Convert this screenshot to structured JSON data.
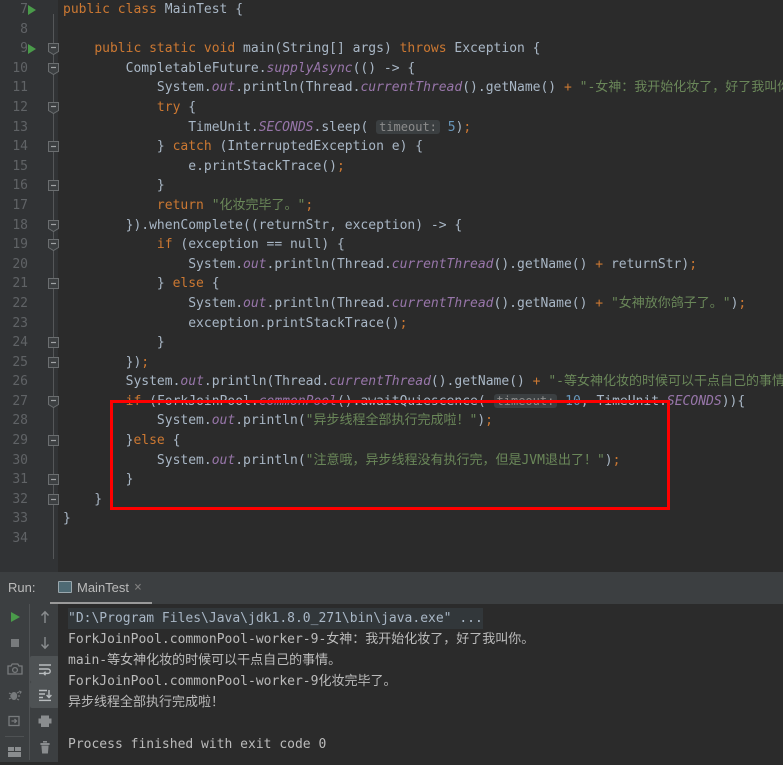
{
  "editor": {
    "first_line": 7,
    "lines": [
      {
        "n": 7,
        "run": true,
        "fold": "none"
      },
      {
        "n": 8,
        "run": false,
        "fold": "none"
      },
      {
        "n": 9,
        "run": true,
        "fold": "open-start"
      },
      {
        "n": 10,
        "run": false,
        "fold": "open-start"
      },
      {
        "n": 11,
        "run": false,
        "fold": "none"
      },
      {
        "n": 12,
        "run": false,
        "fold": "open-start"
      },
      {
        "n": 13,
        "run": false,
        "fold": "none"
      },
      {
        "n": 14,
        "run": false,
        "fold": "open-mid"
      },
      {
        "n": 15,
        "run": false,
        "fold": "none"
      },
      {
        "n": 16,
        "run": false,
        "fold": "open-mid"
      },
      {
        "n": 17,
        "run": false,
        "fold": "none"
      },
      {
        "n": 18,
        "run": false,
        "fold": "open-start"
      },
      {
        "n": 19,
        "run": false,
        "fold": "open-start"
      },
      {
        "n": 20,
        "run": false,
        "fold": "none"
      },
      {
        "n": 21,
        "run": false,
        "fold": "open-mid"
      },
      {
        "n": 22,
        "run": false,
        "fold": "none"
      },
      {
        "n": 23,
        "run": false,
        "fold": "none"
      },
      {
        "n": 24,
        "run": false,
        "fold": "open-mid"
      },
      {
        "n": 25,
        "run": false,
        "fold": "open-mid"
      },
      {
        "n": 26,
        "run": false,
        "fold": "none"
      },
      {
        "n": 27,
        "run": false,
        "fold": "open-start"
      },
      {
        "n": 28,
        "run": false,
        "fold": "none"
      },
      {
        "n": 29,
        "run": false,
        "fold": "open-mid"
      },
      {
        "n": 30,
        "run": false,
        "fold": "none"
      },
      {
        "n": 31,
        "run": false,
        "fold": "open-mid"
      },
      {
        "n": 32,
        "run": false,
        "fold": "open-mid"
      },
      {
        "n": 33,
        "run": false,
        "fold": "none"
      },
      {
        "n": 34,
        "run": false,
        "fold": "none"
      }
    ],
    "code_lines": [
      "public class MainTest {",
      "",
      "    public static void main(String[] args) throws Exception {",
      "        CompletableFuture.supplyAsync(() -> {",
      "            System.out.println(Thread.currentThread().getName() + \"-女神：我开始化妆了，好了我叫你。\");",
      "            try {",
      "                TimeUnit.SECONDS.sleep( timeout: 5);",
      "            } catch (InterruptedException e) {",
      "                e.printStackTrace();",
      "            }",
      "            return \"化妆完毕了。\";",
      "        }).whenComplete((returnStr, exception) -> {",
      "            if (exception == null) {",
      "                System.out.println(Thread.currentThread().getName() + returnStr);",
      "            } else {",
      "                System.out.println(Thread.currentThread().getName() + \"女神放你鸽子了。\");",
      "                exception.printStackTrace();",
      "            }",
      "        });",
      "        System.out.println(Thread.currentThread().getName() + \"-等女神化妆的时候可以干点自己的事情。\");",
      "        if (ForkJoinPool.commonPool().awaitQuiescence( timeout: 10, TimeUnit.SECONDS)){",
      "            System.out.println(\"异步线程全部执行完成啦！\");",
      "        }else {",
      "            System.out.println(\"注意哦，异步线程没有执行完，但是JVM退出了！\");",
      "        }",
      "    }",
      "}",
      ""
    ],
    "inlay_hints": [
      {
        "line": 13,
        "label": "timeout:",
        "value": "5"
      },
      {
        "line": 27,
        "label": "timeout:",
        "value": "10"
      }
    ],
    "strings": {
      "goddess_start": "-女神：我开始化妆了，好了我叫你。",
      "makeup_done": "化妆完毕了。",
      "goddess_ditch": "女神放你鸽子了。",
      "wait_doing_own": "-等女神化妆的时候可以干点自己的事情。",
      "all_async_done": "异步线程全部执行完成啦！",
      "jvm_exited": "注意哦，异步线程没有执行完，但是JVM退出了！"
    },
    "annotation": {
      "shape": "rectangle",
      "color": "#ff0000",
      "covers_lines": "27-31"
    }
  },
  "run_panel": {
    "label": "Run:",
    "tab": {
      "name": "MainTest",
      "close_label": "×",
      "icon": "run-configuration-icon"
    },
    "toolbar_left": [
      {
        "name": "rerun-button",
        "icon": "play-icon"
      },
      {
        "name": "stop-button",
        "icon": "square-icon"
      },
      {
        "name": "screenshot-button",
        "icon": "camera-icon"
      },
      {
        "name": "attach-debugger-button",
        "icon": "bug-icon"
      },
      {
        "name": "export-button",
        "icon": "export-icon"
      },
      {
        "name": "layout-button",
        "icon": "layout-icon"
      }
    ],
    "toolbar_right": [
      {
        "name": "up-the-stack-trace-button",
        "icon": "arrow-up-icon",
        "active": false
      },
      {
        "name": "down-the-stack-trace-button",
        "icon": "arrow-down-icon",
        "active": false
      },
      {
        "name": "soft-wrap-button",
        "icon": "soft-wrap-icon",
        "active": true
      },
      {
        "name": "scroll-to-end-button",
        "icon": "scroll-to-end-icon",
        "active": true
      },
      {
        "name": "print-button",
        "icon": "printer-icon",
        "active": false
      },
      {
        "name": "clear-all-button",
        "icon": "trash-icon",
        "active": false
      }
    ],
    "console_lines": [
      {
        "text": "\"D:\\Program Files\\Java\\jdk1.8.0_271\\bin\\java.exe\" ...",
        "style": "command"
      },
      {
        "text": "ForkJoinPool.commonPool-worker-9-女神：我开始化妆了，好了我叫你。",
        "style": "out"
      },
      {
        "text": "main-等女神化妆的时候可以干点自己的事情。",
        "style": "out"
      },
      {
        "text": "ForkJoinPool.commonPool-worker-9化妆完毕了。",
        "style": "out"
      },
      {
        "text": "异步线程全部执行完成啦！",
        "style": "out"
      },
      {
        "text": "",
        "style": "out"
      },
      {
        "text": "Process finished with exit code 0",
        "style": "out"
      }
    ]
  },
  "colors": {
    "editor_bg": "#2b2b2b",
    "gutter_bg": "#313335",
    "panel_bg": "#3c3f41",
    "text": "#a9b7c6",
    "keyword": "#cc7832",
    "string": "#6a8759",
    "number": "#6897bb",
    "static_field": "#9876aa",
    "annotation_red": "#ff0000",
    "run_green": "#4a9b4a"
  }
}
